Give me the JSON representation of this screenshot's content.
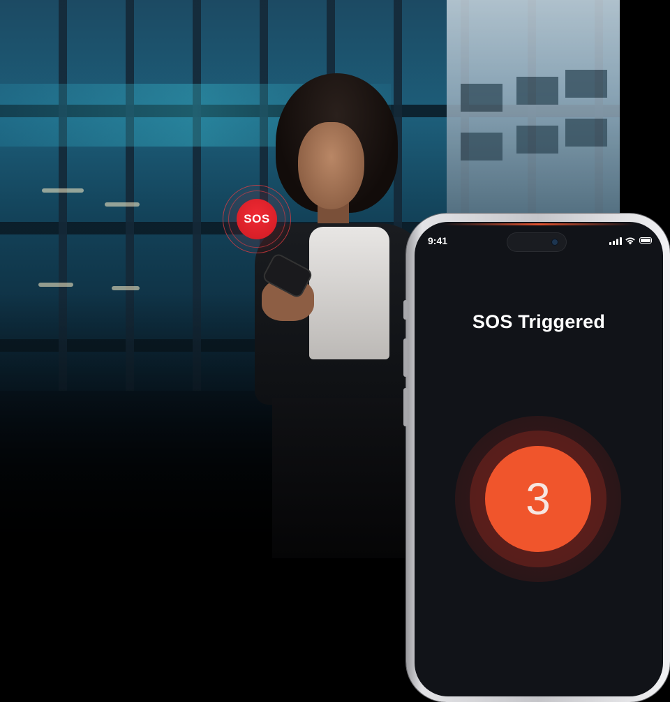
{
  "badge": {
    "label": "SOS",
    "color": "#e2222b"
  },
  "phone": {
    "status_bar": {
      "time": "9:41",
      "icons": [
        "signal-icon",
        "wifi-icon",
        "battery-icon"
      ]
    },
    "title": "SOS Triggered",
    "countdown": {
      "value": "3",
      "color": "#f0552c"
    }
  }
}
